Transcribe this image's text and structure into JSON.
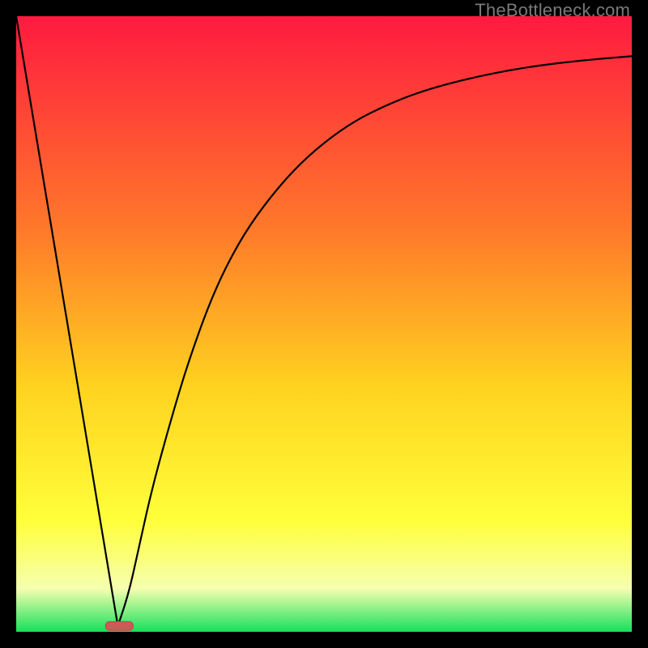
{
  "watermark": "TheBottleneck.com",
  "colors": {
    "black": "#000000",
    "curve": "#000000",
    "marker_fill": "#cc5a57",
    "marker_stroke": "#b84f4d",
    "grad_top": "#ff1a40",
    "grad_mid1": "#ff7a2a",
    "grad_mid2": "#ffd21f",
    "grad_mid3": "#ffff3a",
    "grad_mid4": "#f6ffb0",
    "grad_bottom": "#16e05a"
  },
  "chart_data": {
    "type": "line",
    "title": "",
    "xlabel": "",
    "ylabel": "",
    "xlim": [
      0,
      100
    ],
    "ylim": [
      0,
      100
    ],
    "marker": {
      "x_start": 14.5,
      "x_end": 19.0,
      "y": 1.0
    },
    "series": [
      {
        "name": "left-line",
        "x": [
          0,
          16.5
        ],
        "values": [
          100,
          1
        ]
      },
      {
        "name": "right-curve",
        "x": [
          16.5,
          18,
          20,
          22,
          25,
          28,
          32,
          36,
          40,
          45,
          50,
          55,
          60,
          65,
          70,
          75,
          80,
          85,
          90,
          95,
          100
        ],
        "values": [
          1,
          5,
          14,
          23,
          34,
          44,
          55,
          63,
          69,
          75,
          79.5,
          83,
          85.5,
          87.5,
          89,
          90.2,
          91.2,
          92,
          92.6,
          93.1,
          93.5
        ]
      }
    ],
    "background_gradient_stops": [
      {
        "offset": 0.0,
        "color": "grad_top"
      },
      {
        "offset": 0.35,
        "color": "grad_mid1"
      },
      {
        "offset": 0.6,
        "color": "grad_mid2"
      },
      {
        "offset": 0.82,
        "color": "grad_mid3"
      },
      {
        "offset": 0.93,
        "color": "grad_mid4"
      },
      {
        "offset": 1.0,
        "color": "grad_bottom"
      }
    ]
  }
}
